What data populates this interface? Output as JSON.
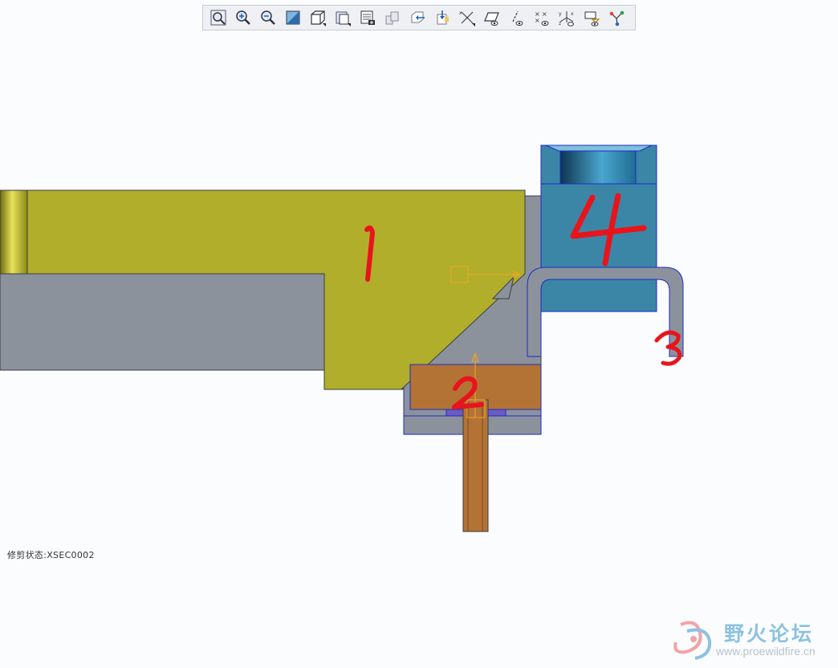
{
  "toolbar": {
    "buttons": [
      {
        "name": "refit-icon"
      },
      {
        "name": "zoom-in-icon"
      },
      {
        "name": "zoom-out-icon"
      },
      {
        "name": "repaint-icon"
      },
      {
        "name": "display-style-icon"
      },
      {
        "name": "saved-views-icon"
      },
      {
        "name": "view-manager-icon"
      },
      {
        "name": "layers-icon"
      },
      {
        "name": "reorient-icon"
      },
      {
        "name": "spin-center-icon"
      },
      {
        "name": "datum-display-icon"
      },
      {
        "name": "plane-display-icon"
      },
      {
        "name": "axis-display-icon"
      },
      {
        "name": "point-display-icon"
      },
      {
        "name": "csys-display-icon"
      },
      {
        "name": "annotation-display-icon"
      },
      {
        "name": "datum-tag-icon"
      }
    ]
  },
  "labels": {
    "part_1": "1",
    "part_2": "2",
    "part_3": "3",
    "part_4": "4"
  },
  "status": {
    "text": "修剪状态:XSEC0002"
  },
  "watermark": {
    "brand": "野火论坛",
    "url": "www.proewildfire.cn"
  },
  "colors": {
    "yellow_part": "#b0ae2a",
    "gray_part": "#8c929b",
    "blue_part": "#3b86a6",
    "brown_part": "#b37335",
    "annotation_red": "#e8141c",
    "edge_blue": "#1b2bc8"
  }
}
